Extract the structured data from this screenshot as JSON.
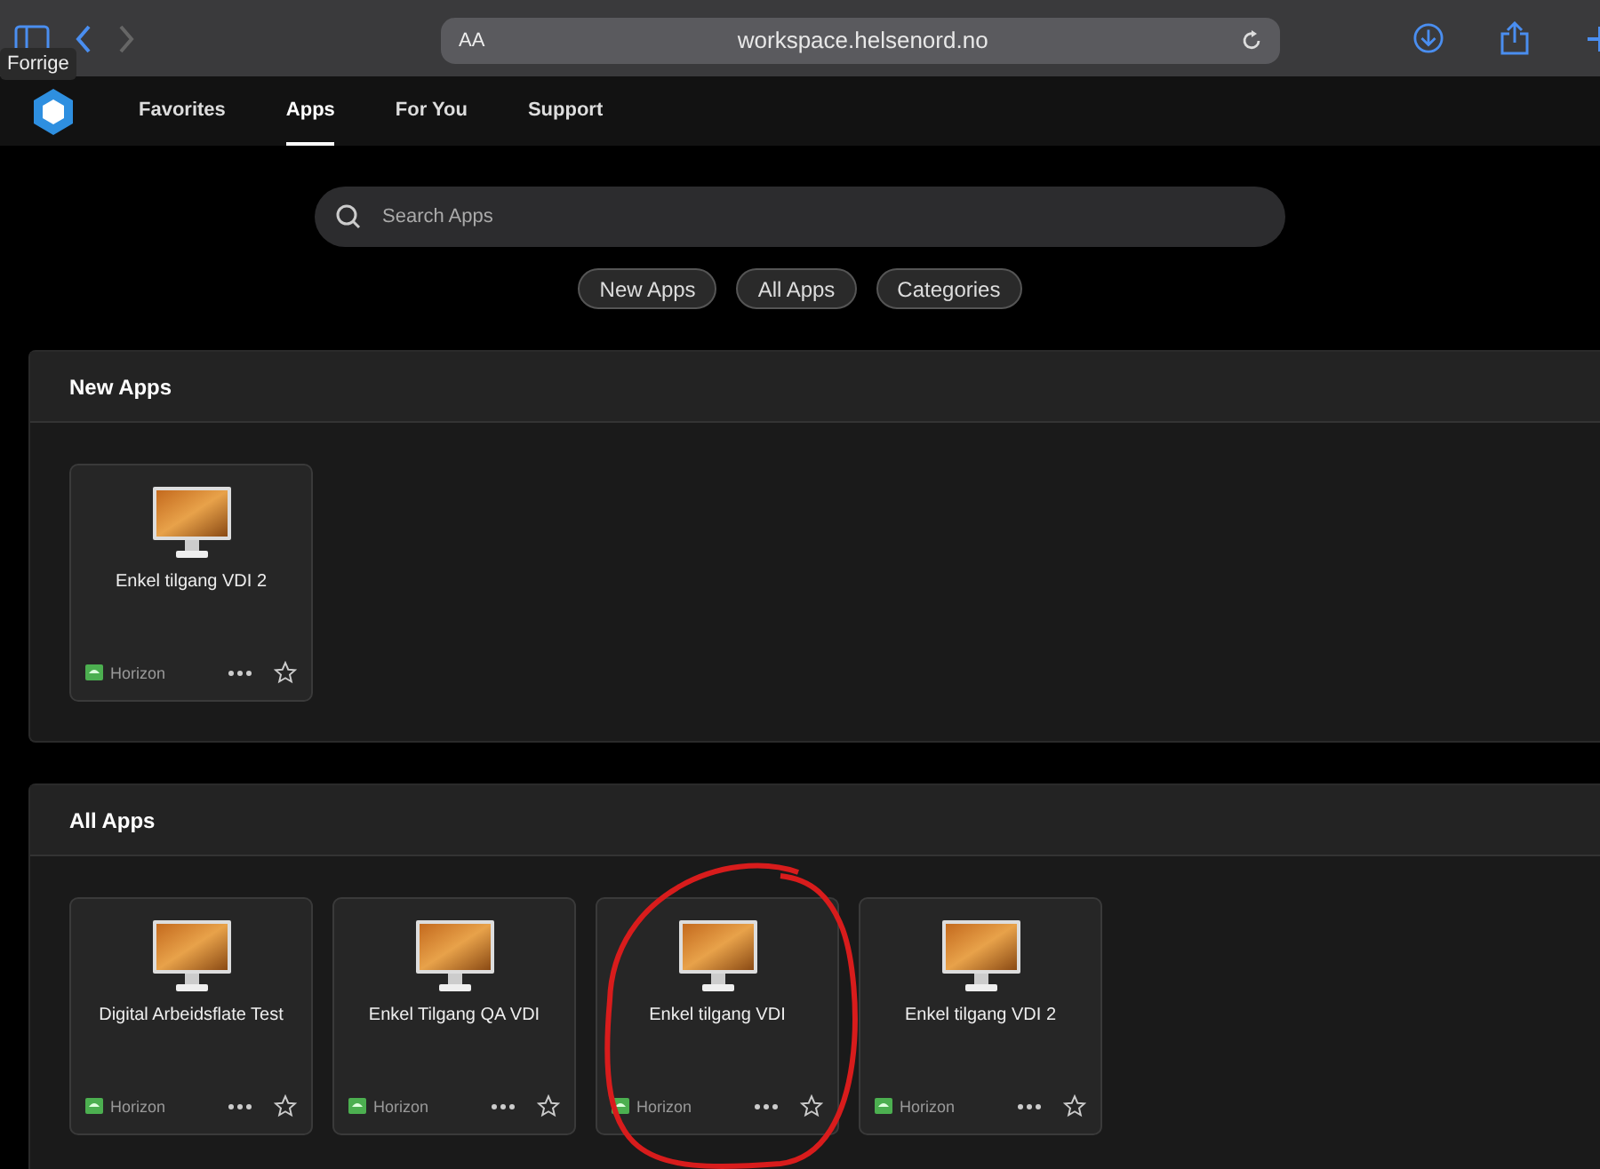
{
  "browser": {
    "tooltip": "Forrige",
    "reader_label": "AA",
    "url": "workspace.helsenord.no"
  },
  "nav": {
    "tabs": [
      {
        "label": "Favorites",
        "selected": false
      },
      {
        "label": "Apps",
        "selected": true
      },
      {
        "label": "For You",
        "selected": false
      },
      {
        "label": "Support",
        "selected": false
      }
    ]
  },
  "search": {
    "placeholder": "Search Apps"
  },
  "filters": [
    "New Apps",
    "All Apps",
    "Categories"
  ],
  "sections": [
    {
      "title": "New Apps",
      "apps": [
        {
          "name": "Enkel tilgang VDI 2",
          "source": "Horizon",
          "circled": false
        }
      ]
    },
    {
      "title": "All Apps",
      "apps": [
        {
          "name": "Digital Arbeidsflate Test",
          "source": "Horizon",
          "circled": false
        },
        {
          "name": "Enkel Tilgang QA VDI",
          "source": "Horizon",
          "circled": false
        },
        {
          "name": "Enkel tilgang VDI",
          "source": "Horizon",
          "circled": true
        },
        {
          "name": "Enkel tilgang VDI 2",
          "source": "Horizon",
          "circled": false
        }
      ]
    }
  ]
}
